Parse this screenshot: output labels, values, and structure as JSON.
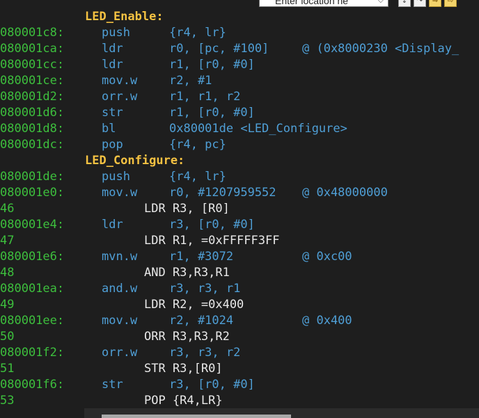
{
  "toolbar": {
    "location_placeholder": "Enter location he",
    "buttons": [
      "step-into",
      "step-over",
      "next-instruction",
      "step-instruction"
    ]
  },
  "listing": [
    {
      "type": "label",
      "text": "LED_Enable:"
    },
    {
      "type": "asm",
      "addr": "080001c8:",
      "mnemonic": "push",
      "operands": "{r4, lr}",
      "comment": ""
    },
    {
      "type": "asm",
      "addr": "080001ca:",
      "mnemonic": "ldr",
      "operands": "r0, [pc, #100]",
      "comment": "@ (0x8000230 <Display_"
    },
    {
      "type": "asm",
      "addr": "080001cc:",
      "mnemonic": "ldr",
      "operands": "r1, [r0, #0]",
      "comment": ""
    },
    {
      "type": "asm",
      "addr": "080001ce:",
      "mnemonic": "mov.w",
      "operands": "r2, #1",
      "comment": ""
    },
    {
      "type": "asm",
      "addr": "080001d2:",
      "mnemonic": "orr.w",
      "operands": "r1, r1, r2",
      "comment": ""
    },
    {
      "type": "asm",
      "addr": "080001d6:",
      "mnemonic": "str",
      "operands": "r1, [r0, #0]",
      "comment": ""
    },
    {
      "type": "asm",
      "addr": "080001d8:",
      "mnemonic": "bl",
      "operands": "0x80001de <LED_Configure>",
      "comment": ""
    },
    {
      "type": "asm",
      "addr": "080001dc:",
      "mnemonic": "pop",
      "operands": "{r4, pc}",
      "comment": ""
    },
    {
      "type": "label",
      "text": "LED_Configure:"
    },
    {
      "type": "asm",
      "addr": "080001de:",
      "mnemonic": "push",
      "operands": "{r4, lr}",
      "comment": ""
    },
    {
      "type": "asm",
      "addr": "080001e0:",
      "mnemonic": "mov.w",
      "operands": "r0, #1207959552",
      "comment": "@ 0x48000000"
    },
    {
      "type": "src",
      "lnum": "46",
      "text": "LDR R3, [R0]"
    },
    {
      "type": "asm",
      "addr": "080001e4:",
      "mnemonic": "ldr",
      "operands": "r3, [r0, #0]",
      "comment": ""
    },
    {
      "type": "src",
      "lnum": "47",
      "text": "LDR R1, =0xFFFFF3FF"
    },
    {
      "type": "asm",
      "addr": "080001e6:",
      "mnemonic": "mvn.w",
      "operands": "r1, #3072",
      "comment": "@ 0xc00"
    },
    {
      "type": "src",
      "lnum": "48",
      "text": "AND R3,R3,R1"
    },
    {
      "type": "asm",
      "addr": "080001ea:",
      "mnemonic": "and.w",
      "operands": "r3, r3, r1",
      "comment": ""
    },
    {
      "type": "src",
      "lnum": "49",
      "text": "LDR R2, =0x400"
    },
    {
      "type": "asm",
      "addr": "080001ee:",
      "mnemonic": "mov.w",
      "operands": "r2, #1024",
      "comment": "@ 0x400"
    },
    {
      "type": "src",
      "lnum": "50",
      "text": "ORR R3,R3,R2"
    },
    {
      "type": "asm",
      "addr": "080001f2:",
      "mnemonic": "orr.w",
      "operands": "r3, r3, r2",
      "comment": ""
    },
    {
      "type": "src",
      "lnum": "51",
      "text": "STR R3,[R0]"
    },
    {
      "type": "asm",
      "addr": "080001f6:",
      "mnemonic": "str",
      "operands": "r3, [r0, #0]",
      "comment": ""
    },
    {
      "type": "src",
      "lnum": "53",
      "text": "POP {R4,LR}"
    }
  ],
  "colors": {
    "background": "#1e1e1e",
    "address": "#3dbf3d",
    "label": "#f5c242",
    "instruction": "#4f9fd6",
    "source": "#e8e8e8"
  }
}
